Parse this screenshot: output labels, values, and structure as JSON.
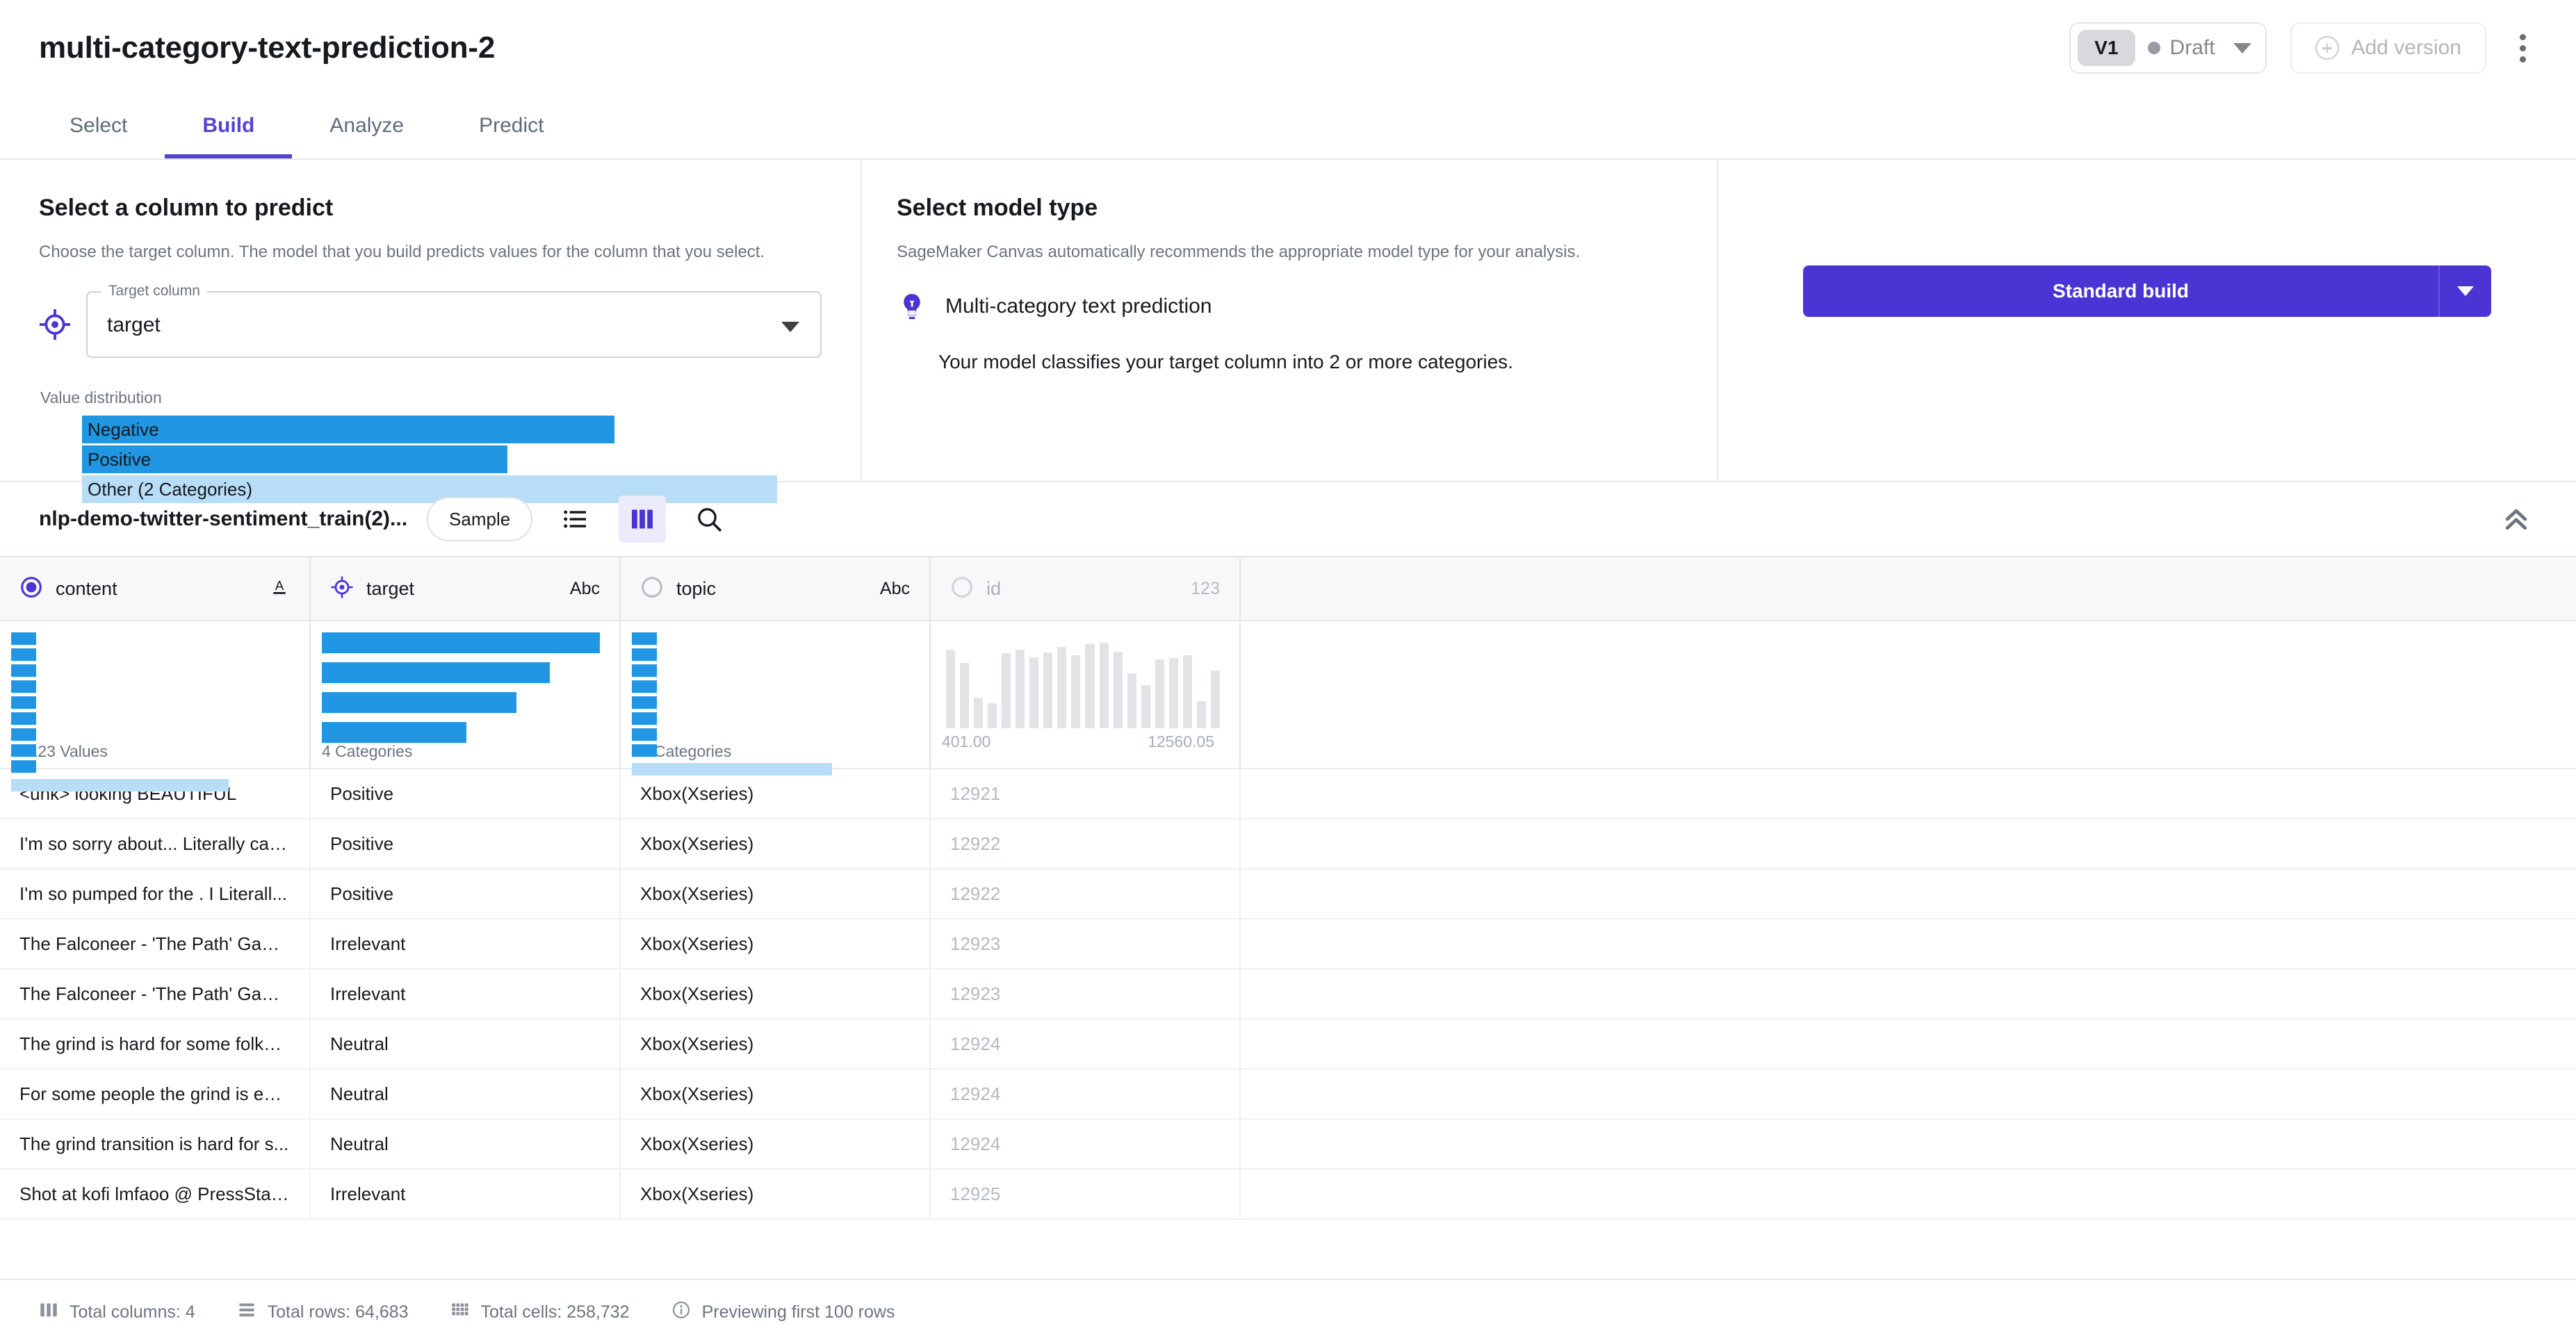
{
  "header": {
    "model_title": "multi-category-text-prediction-2",
    "version_badge": "V1",
    "status_label": "Draft",
    "add_version_label": "Add version"
  },
  "tabs": [
    {
      "label": "Select",
      "active": false
    },
    {
      "label": "Build",
      "active": true
    },
    {
      "label": "Analyze",
      "active": false
    },
    {
      "label": "Predict",
      "active": false
    }
  ],
  "target_panel": {
    "heading": "Select a column to predict",
    "description": "Choose the target column. The model that you build predicts values for the column that you select.",
    "select_legend": "Target column",
    "select_value": "target",
    "distribution_label": "Value distribution",
    "distribution": [
      {
        "label": "Negative",
        "width_pct": 72.0,
        "color": "#2196e3"
      },
      {
        "label": "Positive",
        "width_pct": 57.5,
        "color": "#2196e3"
      },
      {
        "label": "Other (2 Categories)",
        "width_pct": 94.0,
        "color": "#b8ddf6"
      }
    ]
  },
  "model_panel": {
    "heading": "Select model type",
    "description": "SageMaker Canvas automatically recommends the appropriate model type for your analysis.",
    "model_type": "Multi-category text prediction",
    "model_desc": "Your model classifies your target column into 2 or more categories."
  },
  "build_action": {
    "label": "Standard build",
    "accent_color": "#4b34d4"
  },
  "dataset_bar": {
    "dataset_name": "nlp-demo-twitter-sentiment_train(2)...",
    "sample_label": "Sample"
  },
  "table": {
    "columns": [
      {
        "name": "content",
        "type_label": "A",
        "selected": true,
        "muted": false,
        "stat_caption": "19123 Values",
        "stat_kind": "categories-small"
      },
      {
        "name": "target",
        "type_label": "Abc",
        "selected": true,
        "muted": false,
        "stat_caption": "4 Categories",
        "stat_kind": "categories-big"
      },
      {
        "name": "topic",
        "type_label": "Abc",
        "selected": false,
        "muted": false,
        "stat_caption": "28 Categories",
        "stat_kind": "categories-small"
      },
      {
        "name": "id",
        "type_label": "123",
        "selected": false,
        "muted": true,
        "stat_min": "401.00",
        "stat_max": "12560.05",
        "stat_kind": "histogram"
      }
    ],
    "content_bars": [
      9,
      9,
      9,
      9,
      9,
      9,
      9,
      9,
      9
    ],
    "content_other_pct": 78,
    "target_bars_pct": [
      100,
      82,
      70,
      52
    ],
    "topic_bars": [
      9,
      9,
      9,
      9,
      9,
      9,
      9,
      9
    ],
    "topic_other_pct": 72,
    "id_histogram": [
      82,
      68,
      32,
      26,
      78,
      82,
      74,
      79,
      85,
      76,
      88,
      89,
      80,
      57,
      45,
      72,
      73,
      76,
      28,
      60
    ],
    "rows": [
      {
        "content": "<unk> looking BEAUTIFUL",
        "target": "Positive",
        "topic": "Xbox(Xseries)",
        "id": "12921"
      },
      {
        "content": "I'm so sorry about... Literally can...",
        "target": "Positive",
        "topic": "Xbox(Xseries)",
        "id": "12922"
      },
      {
        "content": "I'm so pumped for the . I Literall...",
        "target": "Positive",
        "topic": "Xbox(Xseries)",
        "id": "12922"
      },
      {
        "content": "The Falconeer - 'The Path' Game...",
        "target": "Irrelevant",
        "topic": "Xbox(Xseries)",
        "id": "12923"
      },
      {
        "content": "The Falconeer - 'The Path' Game...",
        "target": "Irrelevant",
        "topic": "Xbox(Xseries)",
        "id": "12923"
      },
      {
        "content": "The grind is hard for some folks ...",
        "target": "Neutral",
        "topic": "Xbox(Xseries)",
        "id": "12924"
      },
      {
        "content": "For some people the grind is eve...",
        "target": "Neutral",
        "topic": "Xbox(Xseries)",
        "id": "12924"
      },
      {
        "content": "The grind transition is hard for s...",
        "target": "Neutral",
        "topic": "Xbox(Xseries)",
        "id": "12924"
      },
      {
        "content": "Shot at kofi lmfaoo @ PressStar...",
        "target": "Irrelevant",
        "topic": "Xbox(Xseries)",
        "id": "12925"
      }
    ]
  },
  "footer": {
    "total_columns": "Total columns: 4",
    "total_rows": "Total rows: 64,683",
    "total_cells": "Total cells: 258,732",
    "preview_note": "Previewing first 100 rows"
  }
}
